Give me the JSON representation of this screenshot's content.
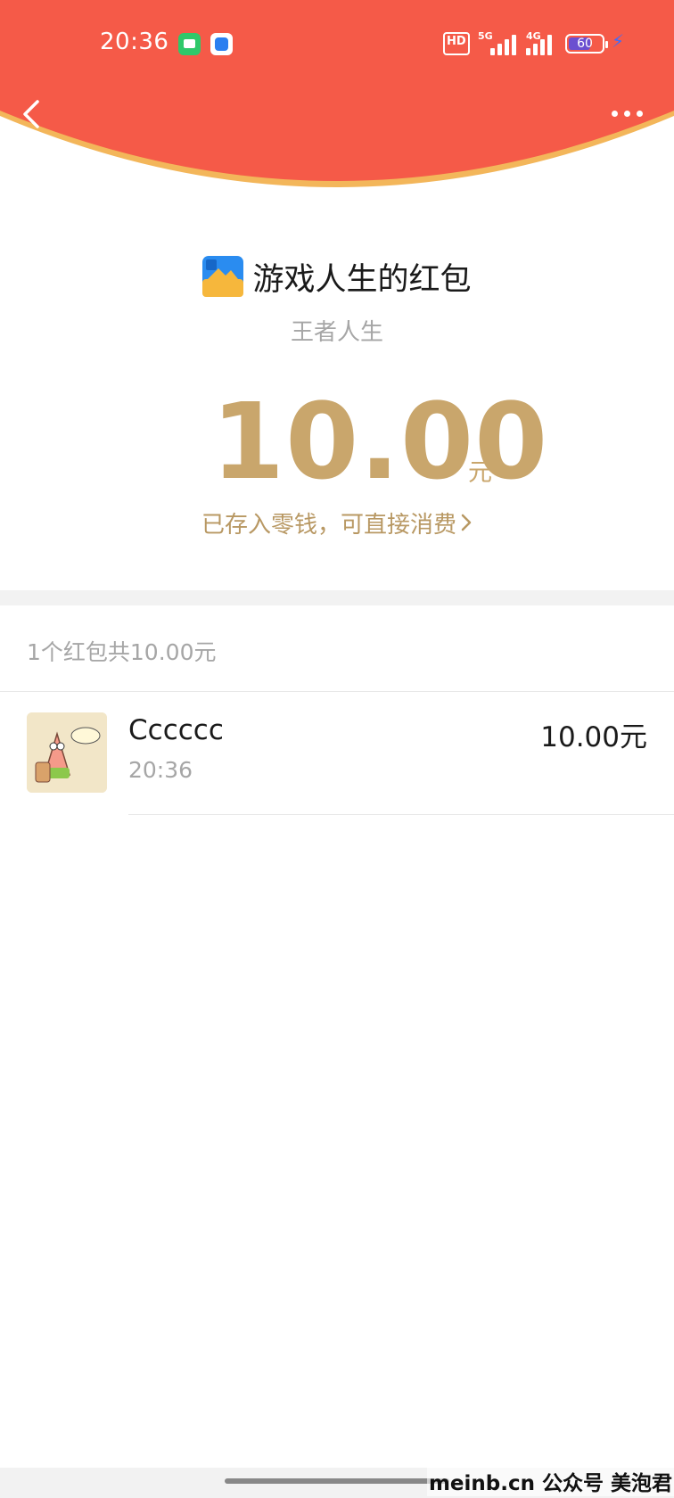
{
  "status_bar": {
    "time": "20:36",
    "hd_label": "HD",
    "signal_5g_label": "5G",
    "signal_4g_label": "4G",
    "battery_level": "60"
  },
  "colors": {
    "header_red": "#f55a48",
    "header_edge": "#f3b65a",
    "gold": "#c9a66c"
  },
  "red_packet": {
    "sender_title": "游戏人生的红包",
    "sender_subtitle": "王者人生",
    "amount": "10.00",
    "amount_unit": "元",
    "deposit_link": "已存入零钱，可直接消费"
  },
  "list": {
    "summary": "1个红包共10.00元",
    "records": [
      {
        "name": "Cccccc",
        "time": "20:36",
        "amount": "10.00元"
      }
    ]
  },
  "watermark": "meinb.cn  公众号 美泡君"
}
